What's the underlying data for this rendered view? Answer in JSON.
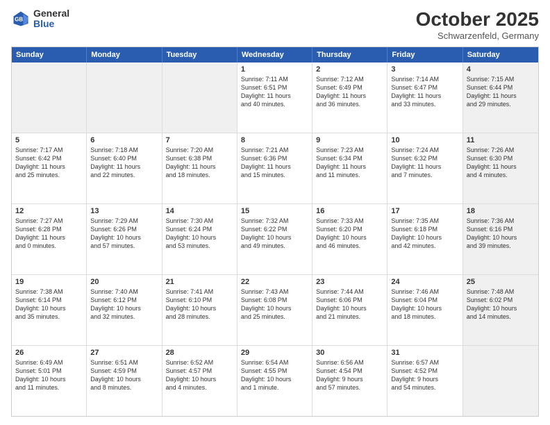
{
  "logo": {
    "general": "General",
    "blue": "Blue"
  },
  "title": "October 2025",
  "location": "Schwarzenfeld, Germany",
  "weekdays": [
    "Sunday",
    "Monday",
    "Tuesday",
    "Wednesday",
    "Thursday",
    "Friday",
    "Saturday"
  ],
  "rows": [
    [
      {
        "day": "",
        "text": "",
        "shaded": true
      },
      {
        "day": "",
        "text": "",
        "shaded": true
      },
      {
        "day": "",
        "text": "",
        "shaded": true
      },
      {
        "day": "1",
        "text": "Sunrise: 7:11 AM\nSunset: 6:51 PM\nDaylight: 11 hours\nand 40 minutes."
      },
      {
        "day": "2",
        "text": "Sunrise: 7:12 AM\nSunset: 6:49 PM\nDaylight: 11 hours\nand 36 minutes."
      },
      {
        "day": "3",
        "text": "Sunrise: 7:14 AM\nSunset: 6:47 PM\nDaylight: 11 hours\nand 33 minutes."
      },
      {
        "day": "4",
        "text": "Sunrise: 7:15 AM\nSunset: 6:44 PM\nDaylight: 11 hours\nand 29 minutes.",
        "shaded": true
      }
    ],
    [
      {
        "day": "5",
        "text": "Sunrise: 7:17 AM\nSunset: 6:42 PM\nDaylight: 11 hours\nand 25 minutes."
      },
      {
        "day": "6",
        "text": "Sunrise: 7:18 AM\nSunset: 6:40 PM\nDaylight: 11 hours\nand 22 minutes."
      },
      {
        "day": "7",
        "text": "Sunrise: 7:20 AM\nSunset: 6:38 PM\nDaylight: 11 hours\nand 18 minutes."
      },
      {
        "day": "8",
        "text": "Sunrise: 7:21 AM\nSunset: 6:36 PM\nDaylight: 11 hours\nand 15 minutes."
      },
      {
        "day": "9",
        "text": "Sunrise: 7:23 AM\nSunset: 6:34 PM\nDaylight: 11 hours\nand 11 minutes."
      },
      {
        "day": "10",
        "text": "Sunrise: 7:24 AM\nSunset: 6:32 PM\nDaylight: 11 hours\nand 7 minutes."
      },
      {
        "day": "11",
        "text": "Sunrise: 7:26 AM\nSunset: 6:30 PM\nDaylight: 11 hours\nand 4 minutes.",
        "shaded": true
      }
    ],
    [
      {
        "day": "12",
        "text": "Sunrise: 7:27 AM\nSunset: 6:28 PM\nDaylight: 11 hours\nand 0 minutes."
      },
      {
        "day": "13",
        "text": "Sunrise: 7:29 AM\nSunset: 6:26 PM\nDaylight: 10 hours\nand 57 minutes."
      },
      {
        "day": "14",
        "text": "Sunrise: 7:30 AM\nSunset: 6:24 PM\nDaylight: 10 hours\nand 53 minutes."
      },
      {
        "day": "15",
        "text": "Sunrise: 7:32 AM\nSunset: 6:22 PM\nDaylight: 10 hours\nand 49 minutes."
      },
      {
        "day": "16",
        "text": "Sunrise: 7:33 AM\nSunset: 6:20 PM\nDaylight: 10 hours\nand 46 minutes."
      },
      {
        "day": "17",
        "text": "Sunrise: 7:35 AM\nSunset: 6:18 PM\nDaylight: 10 hours\nand 42 minutes."
      },
      {
        "day": "18",
        "text": "Sunrise: 7:36 AM\nSunset: 6:16 PM\nDaylight: 10 hours\nand 39 minutes.",
        "shaded": true
      }
    ],
    [
      {
        "day": "19",
        "text": "Sunrise: 7:38 AM\nSunset: 6:14 PM\nDaylight: 10 hours\nand 35 minutes."
      },
      {
        "day": "20",
        "text": "Sunrise: 7:40 AM\nSunset: 6:12 PM\nDaylight: 10 hours\nand 32 minutes."
      },
      {
        "day": "21",
        "text": "Sunrise: 7:41 AM\nSunset: 6:10 PM\nDaylight: 10 hours\nand 28 minutes."
      },
      {
        "day": "22",
        "text": "Sunrise: 7:43 AM\nSunset: 6:08 PM\nDaylight: 10 hours\nand 25 minutes."
      },
      {
        "day": "23",
        "text": "Sunrise: 7:44 AM\nSunset: 6:06 PM\nDaylight: 10 hours\nand 21 minutes."
      },
      {
        "day": "24",
        "text": "Sunrise: 7:46 AM\nSunset: 6:04 PM\nDaylight: 10 hours\nand 18 minutes."
      },
      {
        "day": "25",
        "text": "Sunrise: 7:48 AM\nSunset: 6:02 PM\nDaylight: 10 hours\nand 14 minutes.",
        "shaded": true
      }
    ],
    [
      {
        "day": "26",
        "text": "Sunrise: 6:49 AM\nSunset: 5:01 PM\nDaylight: 10 hours\nand 11 minutes."
      },
      {
        "day": "27",
        "text": "Sunrise: 6:51 AM\nSunset: 4:59 PM\nDaylight: 10 hours\nand 8 minutes."
      },
      {
        "day": "28",
        "text": "Sunrise: 6:52 AM\nSunset: 4:57 PM\nDaylight: 10 hours\nand 4 minutes."
      },
      {
        "day": "29",
        "text": "Sunrise: 6:54 AM\nSunset: 4:55 PM\nDaylight: 10 hours\nand 1 minute."
      },
      {
        "day": "30",
        "text": "Sunrise: 6:56 AM\nSunset: 4:54 PM\nDaylight: 9 hours\nand 57 minutes."
      },
      {
        "day": "31",
        "text": "Sunrise: 6:57 AM\nSunset: 4:52 PM\nDaylight: 9 hours\nand 54 minutes."
      },
      {
        "day": "",
        "text": "",
        "shaded": true
      }
    ]
  ]
}
